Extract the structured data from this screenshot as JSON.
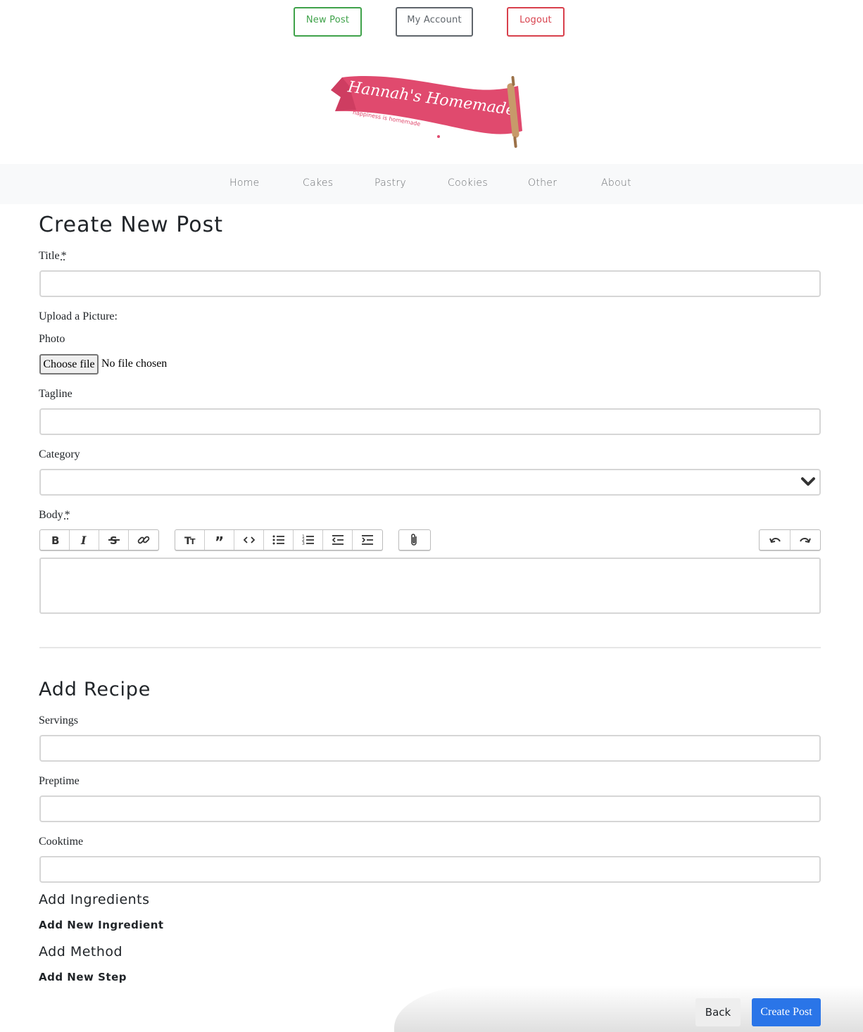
{
  "header": {
    "new_post": "New Post",
    "my_account": "My Account",
    "logout": "Logout"
  },
  "logo": {
    "text": "Hannah's Homemade",
    "tagline": "happiness is homemade",
    "color": "#e04a6e"
  },
  "nav": {
    "items": [
      "Home",
      "Cakes",
      "Pastry",
      "Cookies",
      "Other",
      "About"
    ]
  },
  "form": {
    "page_title": "Create New Post",
    "title_label": "Title",
    "required_mark": "*",
    "upload_label": "Upload a Picture:",
    "photo_label": "Photo",
    "file_button": "Choose file",
    "file_status": "No file chosen",
    "tagline_label": "Tagline",
    "category_label": "Category",
    "body_label": "Body",
    "title_value": "",
    "tagline_value": "",
    "category_value": ""
  },
  "toolbar": {
    "groups": [
      [
        "bold-icon",
        "italic-icon",
        "strikethrough-icon",
        "link-icon"
      ],
      [
        "heading-icon",
        "quote-icon",
        "code-icon",
        "bullet-list-icon",
        "numbered-list-icon",
        "outdent-icon",
        "indent-icon"
      ],
      [
        "attach-icon"
      ],
      [
        "undo-icon",
        "redo-icon"
      ]
    ]
  },
  "recipe": {
    "title": "Add Recipe",
    "servings_label": "Servings",
    "preptime_label": "Preptime",
    "cooktime_label": "Cooktime",
    "ingredients_title": "Add Ingredients",
    "add_ingredient": "Add New Ingredient",
    "method_title": "Add Method",
    "add_step": "Add New Step"
  },
  "actions": {
    "back": "Back",
    "create": "Create Post",
    "create_color": "#2a75e8"
  }
}
